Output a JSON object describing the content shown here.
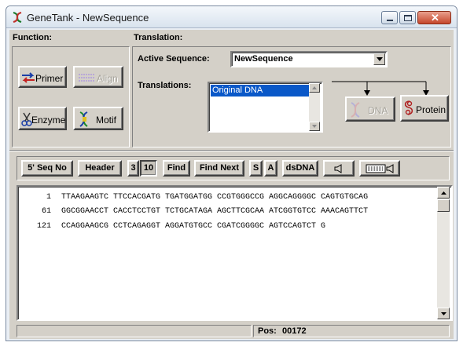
{
  "window": {
    "title": "GeneTank - NewSequence"
  },
  "function_panel": {
    "label": "Function:",
    "primer": "Primer",
    "align": "Align",
    "enzyme": "Enzyme",
    "motif": "Motif"
  },
  "translation_panel": {
    "label": "Translation:",
    "active_label": "Active Sequence:",
    "active_value": "NewSequence",
    "translations_label": "Translations:",
    "translations_items": [
      "Original DNA"
    ],
    "dna_button": "DNA",
    "protein_button": "Protein"
  },
  "toolbar": {
    "seq_no": "5' Seq No",
    "header": "Header",
    "n3": "3",
    "n10": "10",
    "find": "Find",
    "find_next": "Find Next",
    "s": "S",
    "a": "A",
    "dsdna": "dsDNA"
  },
  "sequence": {
    "lines": [
      {
        "num": "1",
        "text": "TTAAGAAGTC TTCCACGATG TGATGGATGG CCGTGGGCCG AGGCAGGGGC CAGTGTGCAG"
      },
      {
        "num": "61",
        "text": "GGCGGAACCT CACCTCCTGT TCTGCATAGA AGCTTCGCAA ATCGGTGTCC AAACAGTTCT"
      },
      {
        "num": "121",
        "text": "CCAGGAAGCG CCTCAGAGGT AGGATGTGCC CGATCGGGGC AGTCCAGTCT G"
      }
    ]
  },
  "status": {
    "pos_label": "Pos:",
    "pos_value": "00172"
  }
}
